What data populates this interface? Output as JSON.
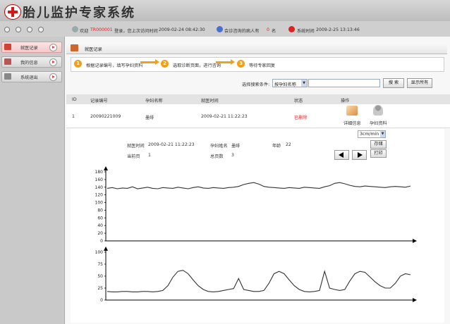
{
  "header": {
    "title": "胎儿监护专家系统"
  },
  "statusbar": {
    "welcome_prefix": "欢迎",
    "user_id": "TR000001",
    "login_text": "登录，您上次访问时间",
    "last_visit": "2009-02-24 08:42:30",
    "consult_text": "会诊咨询的病人有",
    "consult_count": "0",
    "consult_unit": "名",
    "systime_label": "系统时间",
    "systime": "2009-2-25 13:13:46"
  },
  "sidebar": {
    "items": [
      {
        "label": "就医记录",
        "active": true
      },
      {
        "label": "我的信息",
        "active": false
      },
      {
        "label": "系统退出",
        "active": false
      }
    ]
  },
  "page": {
    "title": "就医记录"
  },
  "steps": [
    {
      "num": "1",
      "text": "根据记录编号，填写孕妇资料"
    },
    {
      "num": "2",
      "text": "选取诊断页面，进行咨询"
    },
    {
      "num": "3",
      "text": "等待专家回复"
    }
  ],
  "search": {
    "label": "选择搜索条件:",
    "field_value": "按孕妇名称",
    "query_value": "",
    "search_btn": "搜 索",
    "show_all_btn": "显示所有"
  },
  "table": {
    "headers": [
      "ID",
      "记录编号",
      "孕妇名称",
      "就医时间",
      "状态",
      "操作"
    ],
    "rows": [
      {
        "id": "1",
        "record_no": "20090221009",
        "name": "墨绯",
        "time": "2009-02-21 11:22:23",
        "status": "已删除",
        "action1": "详细信息",
        "action2": "孕妇资料"
      }
    ]
  },
  "detail": {
    "speed": "3cm/min",
    "visit_time_label": "就医时间",
    "visit_time": "2009-02-21 11:22:23",
    "name_label": "孕妇姓名",
    "name": "墨绯",
    "age_label": "年龄",
    "age": "22",
    "cur_page_label": "当前页",
    "cur_page": "1",
    "total_pages_label": "总页数",
    "total_pages": "3",
    "save_btn": "存储",
    "print_btn": "打印"
  },
  "chart_data": [
    {
      "type": "line",
      "title": "",
      "yticks": [
        0,
        20,
        40,
        60,
        80,
        100,
        120,
        140,
        160,
        180
      ],
      "ylim": [
        0,
        180
      ],
      "series": [
        {
          "values": [
            137,
            139,
            136,
            138,
            137,
            141,
            136,
            138,
            140,
            137,
            136,
            139,
            138,
            137,
            140,
            138,
            136,
            139,
            141,
            138,
            137,
            139,
            138,
            137,
            139,
            140,
            142,
            147,
            150,
            152,
            148,
            142,
            140,
            139,
            138,
            137,
            139,
            138,
            137,
            140,
            139,
            138,
            137,
            141,
            144,
            150,
            152,
            149,
            145,
            142,
            141,
            143,
            142,
            141,
            140,
            139,
            141,
            142,
            141,
            140,
            143
          ]
        }
      ]
    },
    {
      "type": "line",
      "title": "",
      "yticks": [
        0,
        25,
        50,
        75,
        100
      ],
      "ylim": [
        0,
        100
      ],
      "series": [
        {
          "values": [
            18,
            17,
            17,
            18,
            18,
            17,
            17,
            18,
            18,
            17,
            18,
            20,
            30,
            48,
            60,
            62,
            55,
            42,
            30,
            22,
            18,
            17,
            18,
            20,
            22,
            24,
            45,
            22,
            20,
            18,
            18,
            20,
            35,
            55,
            60,
            55,
            42,
            30,
            22,
            18,
            17,
            18,
            20,
            60,
            25,
            22,
            20,
            22,
            40,
            55,
            60,
            58,
            48,
            38,
            30,
            25,
            25,
            35,
            50,
            55,
            53
          ]
        }
      ]
    }
  ]
}
